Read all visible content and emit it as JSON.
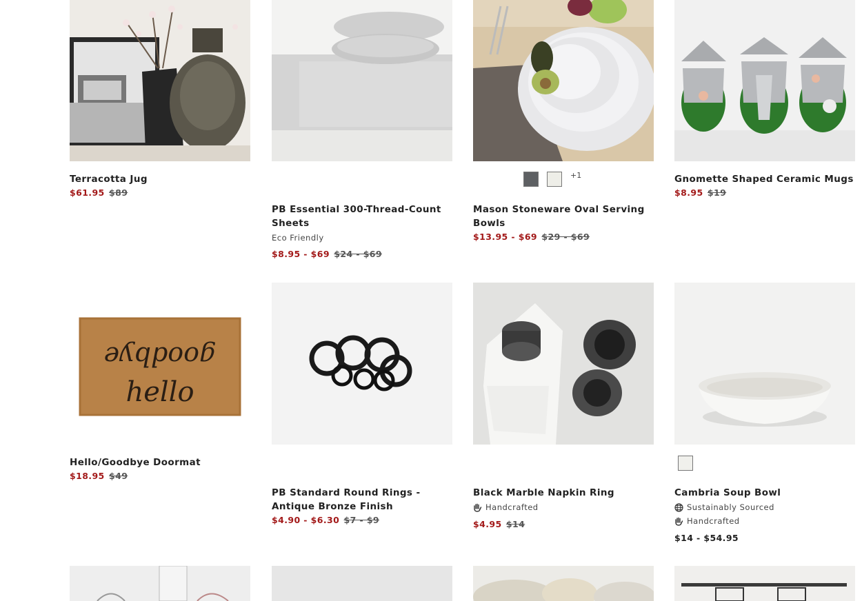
{
  "products": [
    {
      "name": "Terracotta Jug",
      "price_sale": "$61.95",
      "price_orig": "$89"
    },
    {
      "name": "PB Essential 300-Thread-Count Sheets",
      "tag": "Eco Friendly",
      "price_sale": "$8.95 - $69",
      "price_orig": "$24 - $69"
    },
    {
      "name": "Mason Stoneware Oval Serving Bowls",
      "price_sale": "$13.95 - $69",
      "price_orig": "$29 - $69",
      "swatches": [
        "#5e6063",
        "#eeeee8"
      ],
      "swatch_more": "+1"
    },
    {
      "name": "Gnomette Shaped Ceramic Mugs",
      "price_sale": "$8.95",
      "price_orig": "$19"
    },
    {
      "name": "Hello/Goodbye Doormat",
      "price_sale": "$18.95",
      "price_orig": "$49"
    },
    {
      "name": "PB Standard Round Rings - Antique Bronze Finish",
      "price_sale": "$4.90 - $6.30",
      "price_orig": "$7 - $9"
    },
    {
      "name": "Black Marble Napkin Ring",
      "tag": "Handcrafted",
      "price_sale": "$4.95",
      "price_orig": "$14"
    },
    {
      "name": "Cambria Soup Bowl",
      "tag1": "Sustainably Sourced",
      "tag2": "Handcrafted",
      "price": "$14 - $54.95",
      "swatches": [
        "#f0f0ec"
      ]
    }
  ],
  "doormat_text": {
    "top": "goodbye",
    "bottom": "hello"
  },
  "colors": {
    "sale": "#a31a1a",
    "text": "#222222"
  }
}
